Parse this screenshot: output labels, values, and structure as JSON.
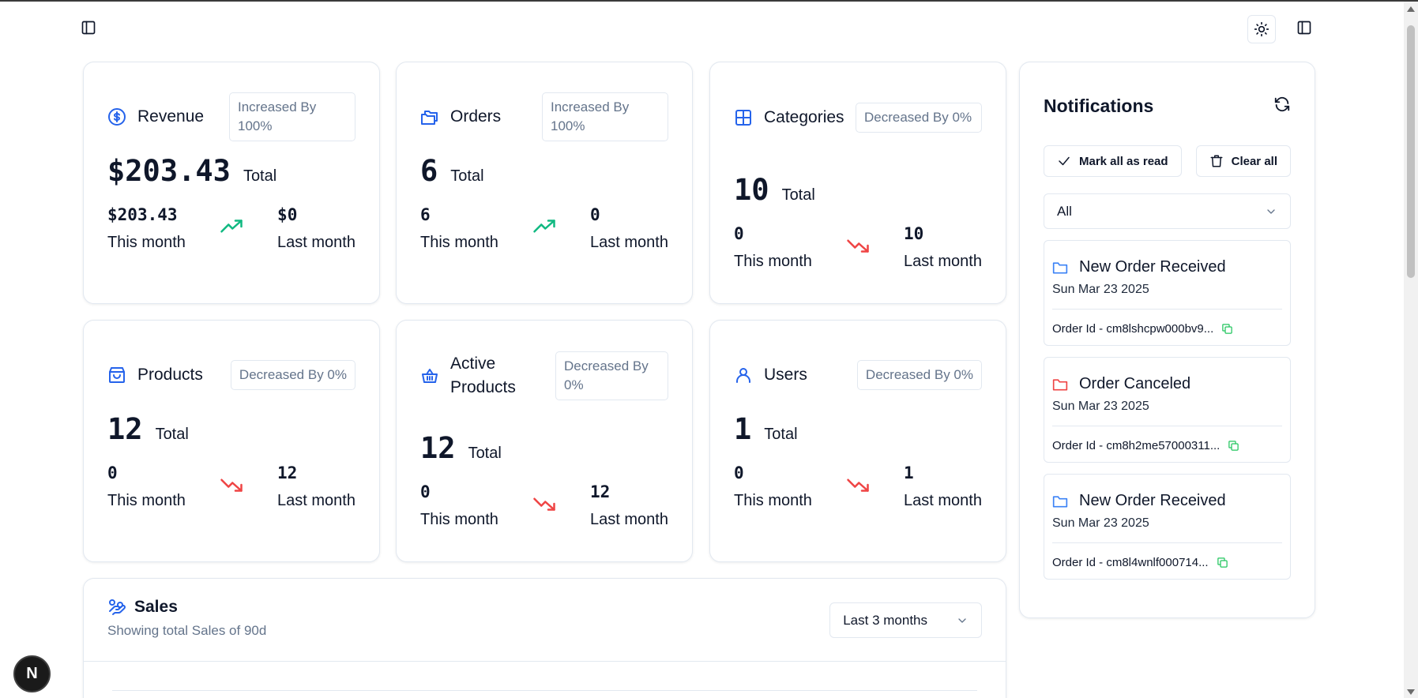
{
  "icons": {
    "sidebar_left": "panel-left-icon",
    "theme": "sun-icon",
    "sidebar_right": "panel-left-icon",
    "trend_up": "trending-up-icon",
    "trend_down": "trending-down-icon"
  },
  "colors": {
    "accent": "#2563eb",
    "up": "#10b981",
    "down": "#ef4444",
    "border": "#e2e8f0",
    "muted": "#64748b"
  },
  "stats": [
    {
      "title": "Revenue",
      "badge": "Increased By 100%",
      "total_prefix": "$",
      "total": "203.43",
      "total_label": "Total",
      "this_prefix": "$",
      "this_value": "203.43",
      "this_label": "This month",
      "last_prefix": "$",
      "last_value": "0",
      "last_label": "Last month",
      "trend": "up",
      "icon": "dollar-circle-icon"
    },
    {
      "title": "Orders",
      "badge": "Increased By 100%",
      "total": "6",
      "total_label": "Total",
      "this_value": "6",
      "this_label": "This month",
      "last_value": "0",
      "last_label": "Last month",
      "trend": "up",
      "icon": "folders-icon"
    },
    {
      "title": "Categories",
      "badge": "Decreased By 0%",
      "total": "10",
      "total_label": "Total",
      "this_value": "0",
      "this_label": "This month",
      "last_value": "10",
      "last_label": "Last month",
      "trend": "down",
      "icon": "grid-icon"
    },
    {
      "title": "Products",
      "badge": "Decreased By 0%",
      "total": "12",
      "total_label": "Total",
      "this_value": "0",
      "this_label": "This month",
      "last_value": "12",
      "last_label": "Last month",
      "trend": "down",
      "icon": "shopping-bag-icon"
    },
    {
      "title": "Active Products",
      "badge": "Decreased By 0%",
      "total": "12",
      "total_label": "Total",
      "this_value": "0",
      "this_label": "This month",
      "last_value": "12",
      "last_label": "Last month",
      "trend": "down",
      "icon": "basket-icon"
    },
    {
      "title": "Users",
      "badge": "Decreased By 0%",
      "total": "1",
      "total_label": "Total",
      "this_value": "0",
      "this_label": "This month",
      "last_value": "1",
      "last_label": "Last month",
      "trend": "down",
      "icon": "user-icon"
    }
  ],
  "notifications": {
    "title": "Notifications",
    "mark_all_label": "Mark all as read",
    "clear_all_label": "Clear all",
    "filter_value": "All",
    "items": [
      {
        "title": "New Order Received",
        "date": "Sun Mar 23 2025",
        "order_id": "Order Id - cm8lshcpw000bv9...",
        "icon_color": "#3b82f6"
      },
      {
        "title": "Order Canceled",
        "date": "Sun Mar 23 2025",
        "order_id": "Order Id - cm8h2me57000311...",
        "icon_color": "#ef4444"
      },
      {
        "title": "New Order Received",
        "date": "Sun Mar 23 2025",
        "order_id": "Order Id - cm8l4wnlf000714...",
        "icon_color": "#3b82f6"
      }
    ]
  },
  "sales": {
    "title": "Sales",
    "subtitle": "Showing total Sales of 90d",
    "range_value": "Last 3 months"
  },
  "floating_badge": "N"
}
